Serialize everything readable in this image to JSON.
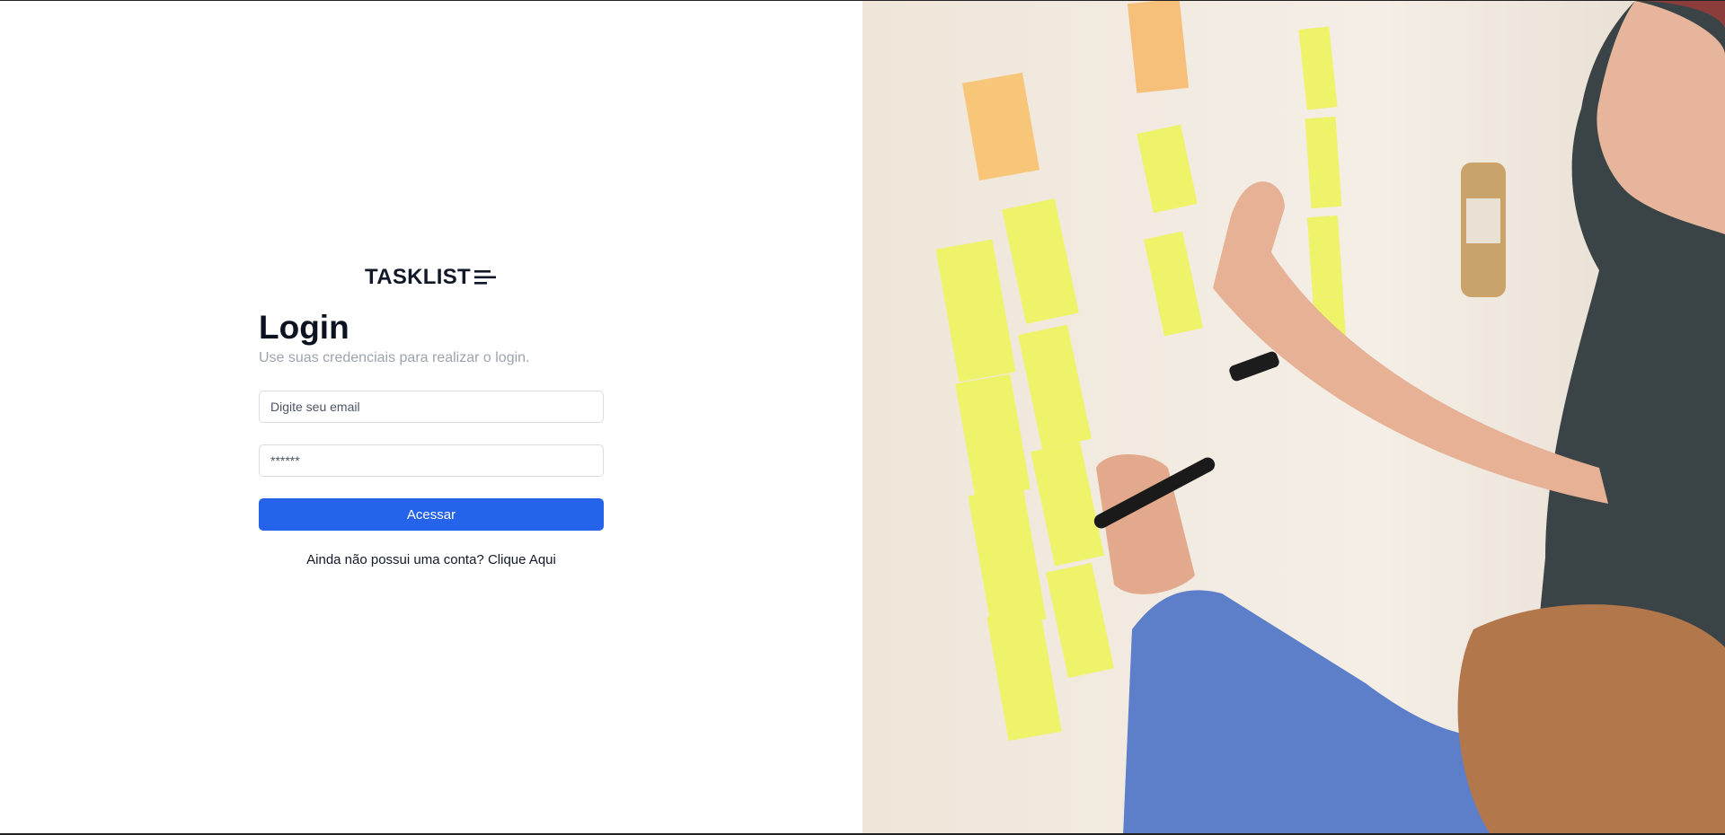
{
  "brand": {
    "name": "TASKLIST",
    "icon": "lines-icon"
  },
  "login": {
    "title": "Login",
    "subtitle": "Use suas credenciais para realizar o login.",
    "email_placeholder": "Digite seu email",
    "password_placeholder": "******",
    "submit_label": "Acessar",
    "signup_prompt": "Ainda não possui uma conta?",
    "signup_link": "Clique Aqui"
  },
  "colors": {
    "primary": "#2563eb",
    "text": "#111827",
    "muted": "#9ca3af"
  },
  "hero": {
    "image": "people-placing-sticky-notes-on-wall"
  }
}
